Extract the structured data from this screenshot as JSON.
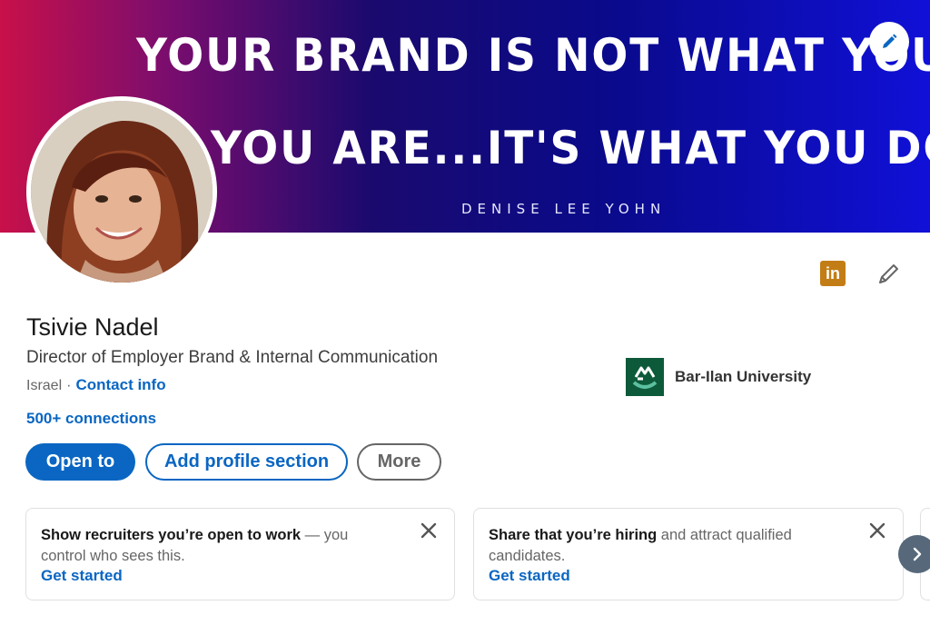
{
  "banner": {
    "line1": "YOUR BRAND IS NOT WHAT YOU SAY",
    "line2": "YOU ARE...IT'S WHAT YOU DO",
    "author": "DENISE LEE YOHN"
  },
  "profile": {
    "name": "Tsivie Nadel",
    "headline": "Director of Employer Brand & Internal Communication",
    "location": "Israel",
    "separator": "·",
    "contact_label": "Contact info",
    "connections": "500+ connections",
    "linkedin_badge": "in"
  },
  "education": {
    "school": "Bar-Ilan University"
  },
  "actions": {
    "open_to": "Open to",
    "add_section": "Add profile section",
    "more": "More"
  },
  "cards": [
    {
      "bold": "Show recruiters you’re open to work",
      "rest": " — you control who sees this.",
      "link": "Get started"
    },
    {
      "bold": "Share that you’re hiring",
      "rest": " and attract qualified candidates.",
      "link": "Get started"
    }
  ],
  "colors": {
    "accent": "#0a66c2",
    "banner_left": "#c8104a",
    "banner_right": "#1010d8",
    "school_logo": "#0d5a3a",
    "linkedin_badge": "#c37d16"
  },
  "icons": [
    "pencil-icon",
    "linkedin-icon",
    "close-icon",
    "chevron-right-icon",
    "school-logo-icon"
  ]
}
